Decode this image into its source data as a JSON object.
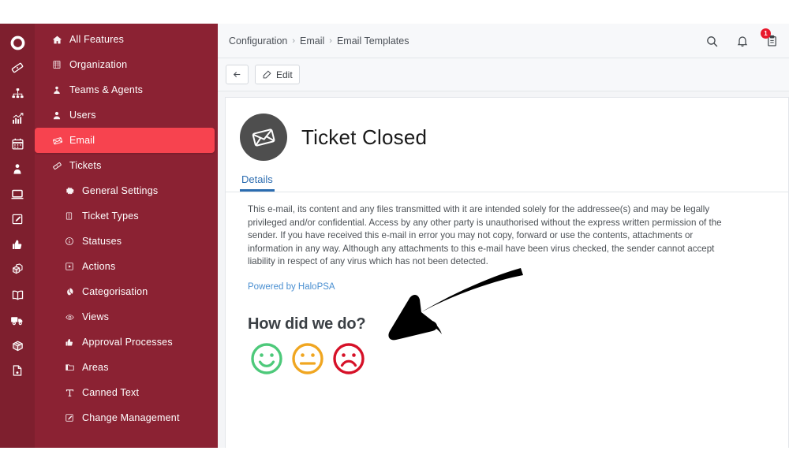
{
  "app": {
    "brand_color": "#8b2233",
    "rail_color": "#7e1f2e",
    "accent_color": "#f7434f",
    "link_color": "#4a8fd1"
  },
  "icon_rail": {
    "items": [
      {
        "name": "logo-icon",
        "label": "Halo"
      },
      {
        "name": "ticket-icon",
        "label": "Tickets"
      },
      {
        "name": "sitemap-icon",
        "label": "Organisation Chart"
      },
      {
        "name": "chart-line-icon",
        "label": "Reporting"
      },
      {
        "name": "calendar-icon",
        "label": "Calendar"
      },
      {
        "name": "user-pin-icon",
        "label": "Customers"
      },
      {
        "name": "laptop-icon",
        "label": "Assets"
      },
      {
        "name": "edit-note-icon",
        "label": "Quotations"
      },
      {
        "name": "thumbs-up-icon",
        "label": "Approvals"
      },
      {
        "name": "boxes-icon",
        "label": "Stock"
      },
      {
        "name": "book-icon",
        "label": "Knowledge Base"
      },
      {
        "name": "truck-icon",
        "label": "Suppliers"
      },
      {
        "name": "package-icon",
        "label": "Items"
      },
      {
        "name": "contract-icon",
        "label": "Contracts"
      }
    ]
  },
  "sidebar": {
    "items": [
      {
        "label": "All Features",
        "icon": "home-icon",
        "sub": false,
        "active": false
      },
      {
        "label": "Organization",
        "icon": "building-icon",
        "sub": false,
        "active": false
      },
      {
        "label": "Teams & Agents",
        "icon": "user-tie-icon",
        "sub": false,
        "active": false
      },
      {
        "label": "Users",
        "icon": "user-icon",
        "sub": false,
        "active": false
      },
      {
        "label": "Email",
        "icon": "envelope-icon",
        "sub": false,
        "active": true
      },
      {
        "label": "Tickets",
        "icon": "ticket-icon",
        "sub": false,
        "active": false
      },
      {
        "label": "General Settings",
        "icon": "gear-icon",
        "sub": true,
        "active": false
      },
      {
        "label": "Ticket Types",
        "icon": "list-icon",
        "sub": true,
        "active": false
      },
      {
        "label": "Statuses",
        "icon": "info-circle-icon",
        "sub": true,
        "active": false
      },
      {
        "label": "Actions",
        "icon": "play-box-icon",
        "sub": true,
        "active": false
      },
      {
        "label": "Categorisation",
        "icon": "pie-slice-icon",
        "sub": true,
        "active": false
      },
      {
        "label": "Views",
        "icon": "eye-icon",
        "sub": true,
        "active": false
      },
      {
        "label": "Approval Processes",
        "icon": "thumbs-up-icon",
        "sub": true,
        "active": false
      },
      {
        "label": "Areas",
        "icon": "folder-icon",
        "sub": true,
        "active": false
      },
      {
        "label": "Canned Text",
        "icon": "text-t-icon",
        "sub": true,
        "active": false
      },
      {
        "label": "Change Management",
        "icon": "edit-note-icon",
        "sub": true,
        "active": false
      }
    ]
  },
  "header": {
    "breadcrumb": [
      "Configuration",
      "Email",
      "Email Templates"
    ],
    "separator": "›",
    "actions": [
      {
        "name": "search-icon",
        "label": "Search"
      },
      {
        "name": "bell-icon",
        "label": "Notifications"
      },
      {
        "name": "clipboard-icon",
        "label": "Tasks",
        "badge": "1"
      }
    ]
  },
  "toolbar": {
    "back_label": "",
    "edit_label": "Edit"
  },
  "main": {
    "title": "Ticket Closed",
    "avatar_icon": "envelope-icon",
    "tabs": [
      {
        "label": "Details",
        "active": true
      }
    ],
    "legal_text": "This e-mail, its content and any files transmitted with it are intended solely for the addressee(s) and may be legally privileged and/or confidential. Access by any other party is unauthorised without the express written permission of the sender. If you have received this e-mail in error you may not copy, forward or use the contents, attachments or information in any way. Although any attachments to this e-mail have been virus checked, the sender cannot accept liability in respect of any virus which has not been detected.",
    "powered_by": "Powered by HaloPSA",
    "survey": {
      "question": "How did we do?",
      "options": [
        {
          "name": "face-happy-icon",
          "label": "Happy",
          "color": "#4dc97a"
        },
        {
          "name": "face-neutral-icon",
          "label": "Neutral",
          "color": "#f0a621"
        },
        {
          "name": "face-sad-icon",
          "label": "Sad",
          "color": "#d61128"
        }
      ]
    },
    "annotation": {
      "name": "arrow-annotation",
      "label": "arrow pointing to rating faces",
      "color": "#000000"
    }
  }
}
